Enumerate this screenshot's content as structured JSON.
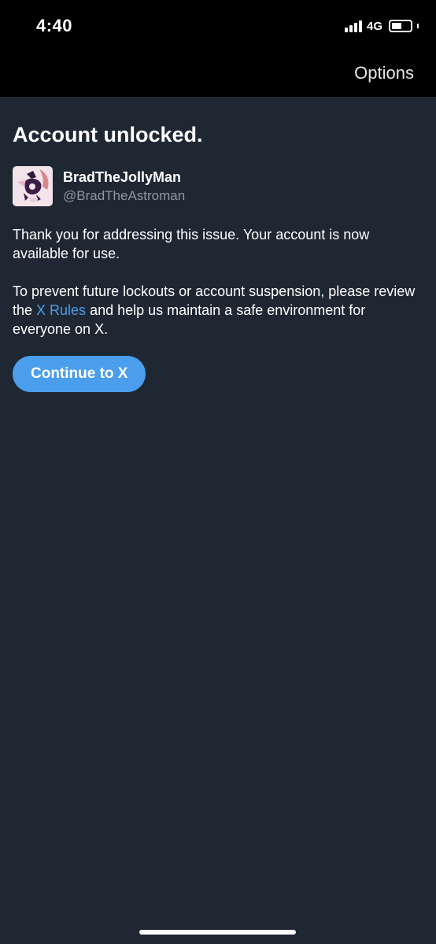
{
  "status_bar": {
    "time": "4:40",
    "network": "4G"
  },
  "header": {
    "options_label": "Options"
  },
  "page": {
    "title": "Account unlocked."
  },
  "account": {
    "display_name": "BradTheJollyMan",
    "handle": "@BradTheAstroman"
  },
  "message": {
    "paragraph1": "Thank you for addressing this issue. Your account is now available for use.",
    "paragraph2_before": "To prevent future lockouts or account suspension, please review the ",
    "paragraph2_link": "X Rules",
    "paragraph2_after": " and help us maintain a safe environment for everyone on X."
  },
  "actions": {
    "continue_label": "Continue to X"
  },
  "colors": {
    "background": "#1f2733",
    "accent": "#4a9eeb",
    "handle": "#8b98a5"
  }
}
